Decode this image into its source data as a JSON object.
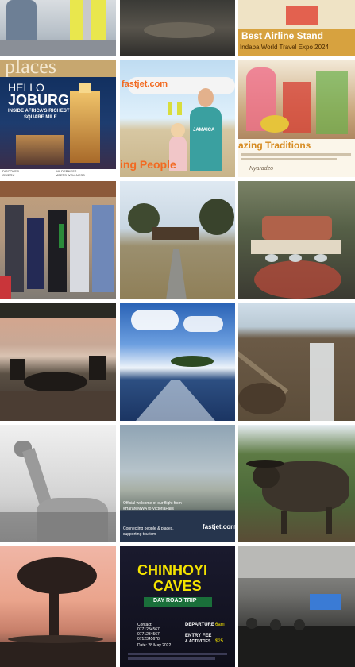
{
  "tiles": {
    "airline_stand": {
      "title": "Best Airline Stand",
      "subtitle": "Indaba World Travel Expo 2024"
    },
    "joburg": {
      "header_word": "places",
      "title_line1": "HELLO",
      "title_line2": "JOBURG",
      "subtitle_line1": "INSIDE AFRICA'S RICHEST",
      "subtitle_line2": "SQUARE MILE",
      "footer_left_1": "DISCOVER",
      "footer_left_2": "OWERU",
      "footer_right_1": "WILDERNESS",
      "footer_right_2": "MEETS WELLNESS"
    },
    "fastjet_family": {
      "brand": "fastjet.com",
      "shirt": "JAMAICA",
      "caption": "ing People"
    },
    "traditions": {
      "title": "azing Traditions",
      "signature": "Nyaradzo"
    },
    "vic_falls_flight": {
      "line1": "Official welcome of our flight from",
      "line2": "#HarareMWA to VictoriaFalls",
      "line3": "Connecting people & places,",
      "line4": "supporting tourism",
      "brand": "fastjet.com"
    },
    "chinhoyi": {
      "title_line1": "CHINHOYI",
      "title_line2": "CAVES",
      "ribbon": "DAY ROAD TRIP",
      "contact_label": "Contact:",
      "contact_1": "0771234567",
      "contact_2": "0771234567",
      "contact_3": "0712345678",
      "date_label": "Date: 28 May 2022",
      "departure_label": "DEPARTURE",
      "departure_value": "6am",
      "fee_label": "ENTRY FEE",
      "fee_sub": "& ACTIVITIES",
      "fee_value": "$25"
    }
  },
  "colors": {
    "accent_gold": "#e8b423",
    "fastjet_orange": "#f26a21",
    "caves_yellow": "#f4e300",
    "sky_blue": "#3a7bd5"
  }
}
